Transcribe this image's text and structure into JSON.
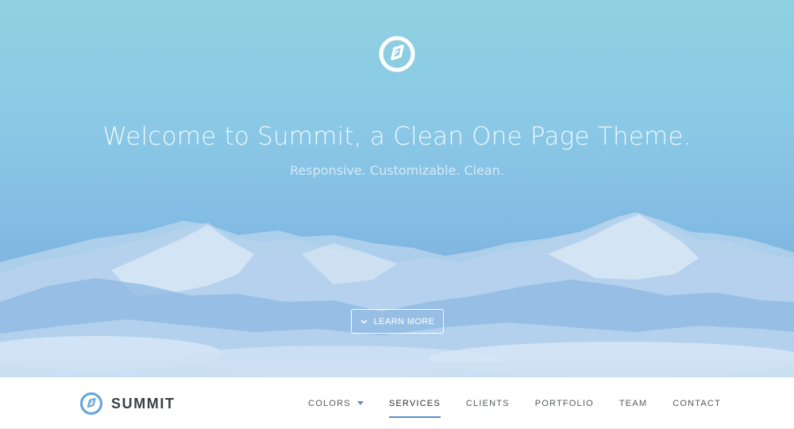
{
  "hero": {
    "title": "Welcome to Summit, a Clean One Page Theme.",
    "subtitle": "Responsive. Customizable. Clean.",
    "cta_label": "LEARN MORE",
    "logo_icon": "summit-logo-icon"
  },
  "navbar": {
    "brand_name": "SUMMIT",
    "brand_icon": "summit-logo-icon",
    "items": [
      {
        "label": "COLORS",
        "has_dropdown": true,
        "active": false
      },
      {
        "label": "SERVICES",
        "has_dropdown": false,
        "active": true
      },
      {
        "label": "CLIENTS",
        "has_dropdown": false,
        "active": false
      },
      {
        "label": "PORTFOLIO",
        "has_dropdown": false,
        "active": false
      },
      {
        "label": "TEAM",
        "has_dropdown": false,
        "active": false
      },
      {
        "label": "CONTACT",
        "has_dropdown": false,
        "active": false
      }
    ]
  },
  "colors": {
    "accent": "#5a8fc7",
    "sky_top": "#8fd1e1",
    "sky_bottom": "#78aadf",
    "brand_text": "#3b3f43"
  }
}
